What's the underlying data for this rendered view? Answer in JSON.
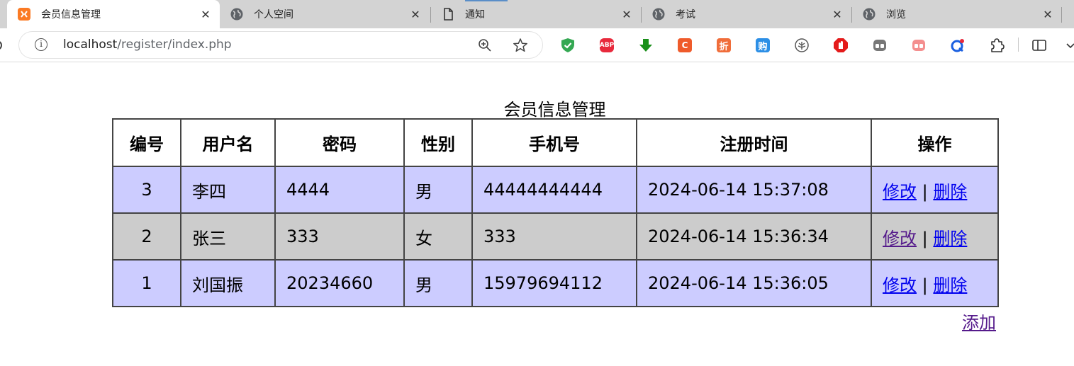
{
  "tabs": [
    {
      "title": "会员信息管理",
      "icon": "xampp-icon",
      "active": true
    },
    {
      "title": "个人空间",
      "icon": "globe-icon",
      "active": false
    },
    {
      "title": "通知",
      "icon": "document-icon",
      "active": false
    },
    {
      "title": "考试",
      "icon": "globe-icon",
      "active": false
    },
    {
      "title": "浏览",
      "icon": "globe-icon",
      "active": false
    }
  ],
  "tab_close_glyph": "✕",
  "address_bar": {
    "host": "localhost",
    "path": "/register/index.php",
    "info_glyph": "i"
  },
  "extensions": [
    {
      "name": "shield-check-extension-icon",
      "color": "#34a853"
    },
    {
      "name": "adblock-plus-extension-icon",
      "label": "ABP",
      "color": "#e8293c"
    },
    {
      "name": "download-arrow-extension-icon",
      "color": "#1a8f1a"
    },
    {
      "name": "c-extension-icon",
      "label": "C",
      "color": "#ef5b2b"
    },
    {
      "name": "zhe-extension-icon",
      "label": "折",
      "color": "#f06d3a"
    },
    {
      "name": "translate-extension-icon",
      "label": "购",
      "color": "#2c8fe6"
    },
    {
      "name": "palm-extension-icon",
      "color": "#555555"
    },
    {
      "name": "red-shield-extension-icon",
      "color": "#e41b1b"
    },
    {
      "name": "gray-face-extension-icon",
      "color": "#777777"
    },
    {
      "name": "pink-face-extension-icon",
      "color": "#f48f8f"
    },
    {
      "name": "q-extension-icon",
      "color": "#1a5fe0"
    }
  ],
  "page": {
    "caption": "会员信息管理",
    "headers": [
      "编号",
      "用户名",
      "密码",
      "性别",
      "手机号",
      "注册时间",
      "操作"
    ],
    "rows": [
      {
        "id": "3",
        "username": "李四",
        "password": "4444",
        "gender": "男",
        "phone": "44444444444",
        "registered": "2024-06-14 15:37:08",
        "edit_visited": false
      },
      {
        "id": "2",
        "username": "张三",
        "password": "333",
        "gender": "女",
        "phone": "333",
        "registered": "2024-06-14 15:36:34",
        "edit_visited": true
      },
      {
        "id": "1",
        "username": "刘国振",
        "password": "20234660",
        "gender": "男",
        "phone": "15979694112",
        "registered": "2024-06-14 15:36:05",
        "edit_visited": false
      }
    ],
    "edit_label": "修改",
    "separator": "|",
    "delete_label": "删除",
    "add_label": "添加"
  },
  "colors": {
    "row_odd": "#ccccff",
    "row_even": "#cccccc",
    "link": "#0000ee",
    "link_visited": "#551a8b",
    "xampp_orange": "#fb7a24"
  }
}
